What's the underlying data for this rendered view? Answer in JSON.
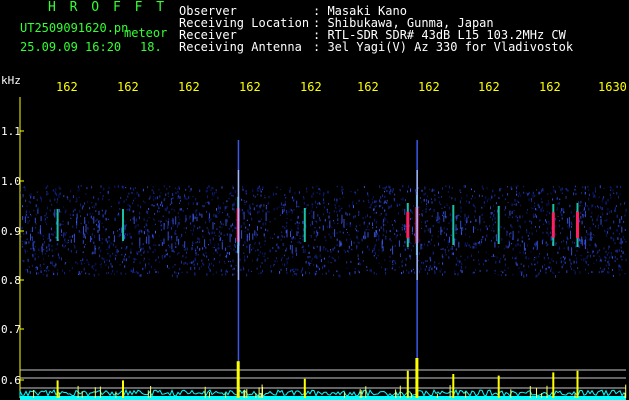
{
  "header": {
    "logo": "H R O F F T",
    "filename": "UT2509091620.pn",
    "subtitle": "meteor",
    "datetime": "25.09.09 16:20",
    "extra": "18.",
    "labels": [
      "Observer",
      "Receiving Location",
      "Receiver",
      "Receiving Antenna"
    ],
    "values": [
      ": Masaki Kano",
      ": Shibukawa, Gunma, Japan",
      ": RTL-SDR SDR# 43dB L15 103.2MHz CW",
      ": 3el Yagi(V) Az 330 for Vladivostok"
    ]
  },
  "time_axis": {
    "ticks": [
      "162",
      "162",
      "162",
      "162",
      "162",
      "162",
      "162",
      "162",
      "162",
      "1630"
    ]
  },
  "freq_axis": {
    "unit": "kHz",
    "ticks": [
      "1.1",
      "1.0",
      "0.9",
      "0.8",
      "0.7",
      "0.6"
    ]
  },
  "colors": {
    "background": "#000000",
    "noise_low": "#0a1a8c",
    "noise_high": "#4060ff",
    "echo_hot": "#ff2060",
    "echo_mid": "#20e0c0",
    "bottom_trace": "#00ffff",
    "peak_trace": "#ffff00",
    "axis_text": "#ffff00"
  },
  "echoes": [
    {
      "time_fraction": 0.062,
      "strength": 0.3
    },
    {
      "time_fraction": 0.17,
      "strength": 0.3
    },
    {
      "time_fraction": 0.36,
      "strength": 0.9
    },
    {
      "time_fraction": 0.47,
      "strength": 0.35
    },
    {
      "time_fraction": 0.64,
      "strength": 0.6
    },
    {
      "time_fraction": 0.655,
      "strength": 1.0
    },
    {
      "time_fraction": 0.715,
      "strength": 0.5
    },
    {
      "time_fraction": 0.79,
      "strength": 0.45
    },
    {
      "time_fraction": 0.88,
      "strength": 0.55
    },
    {
      "time_fraction": 0.92,
      "strength": 0.6
    }
  ]
}
